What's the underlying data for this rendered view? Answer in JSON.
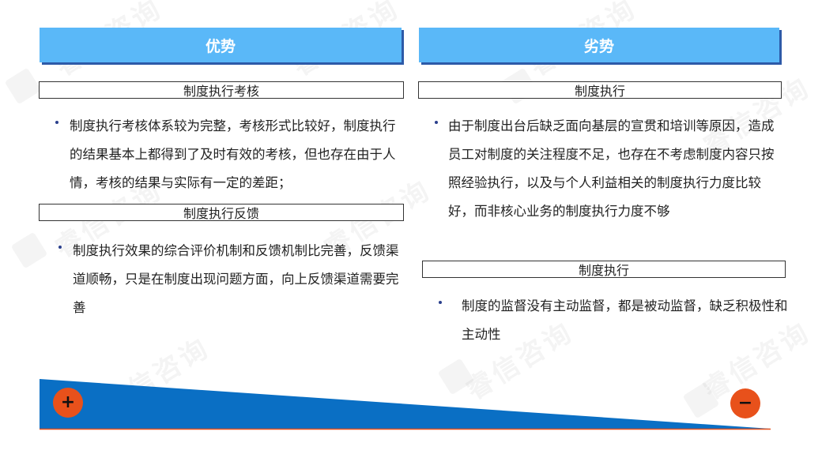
{
  "watermark": {
    "text": "睿信咨询"
  },
  "left": {
    "header": "优势",
    "sections": [
      {
        "title": "制度执行考核",
        "bullet": "制度执行考核体系较为完整，考核形式比较好，制度执行的结果基本上都得到了及时有效的考核，但也存在由于人情，考核的结果与实际有一定的差距；"
      },
      {
        "title": "制度执行反馈",
        "bullet": "制度执行效果的综合评价机制和反馈机制比完善，反馈渠道顺畅，只是在制度出现问题方面，向上反馈渠道需要完善"
      }
    ]
  },
  "right": {
    "header": "劣势",
    "sections": [
      {
        "title": "制度执行",
        "bullet": "由于制度出台后缺乏面向基层的宣贯和培训等原因，造成员工对制度的关注程度不足，也存在不考虑制度内容只按照经验执行，以及与个人利益相关的制度执行力度比较好，而非核心业务的制度执行力度不够"
      },
      {
        "title": "制度执行",
        "bullet": "制度的监督没有主动监督，都是被动监督，缺乏积极性和主动性"
      }
    ]
  },
  "footer": {
    "plus_symbol": "+",
    "minus_symbol": "−"
  },
  "colors": {
    "header_bg": "#5ab8f8",
    "header_shadow": "#2d5aa8",
    "wedge": "#0a6fc4",
    "accent": "#e8511b"
  }
}
